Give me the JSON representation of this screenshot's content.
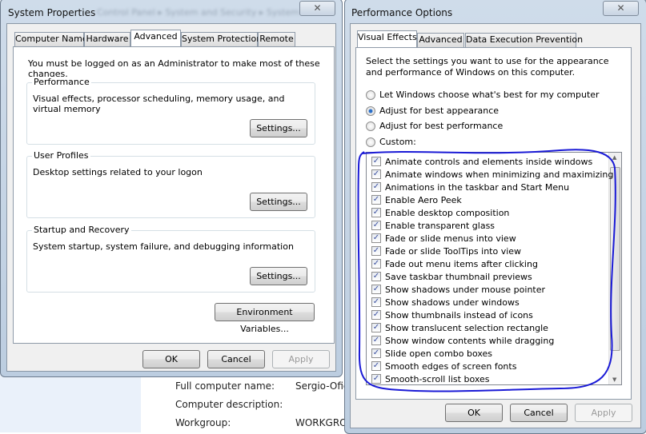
{
  "background": {
    "breadcrumb": "Control Panel ▸ System and Security ▸ System",
    "rows": [
      {
        "label": "Full computer name:",
        "value": "Sergio-Ofic"
      },
      {
        "label": "Computer description:",
        "value": ""
      },
      {
        "label": "Workgroup:",
        "value": "WORKGROU"
      }
    ]
  },
  "system_properties": {
    "title": "System Properties",
    "close_icon": "close-icon",
    "tabs": [
      {
        "label": "Computer Name"
      },
      {
        "label": "Hardware"
      },
      {
        "label": "Advanced",
        "selected": true
      },
      {
        "label": "System Protection"
      },
      {
        "label": "Remote"
      }
    ],
    "admin_note": "You must be logged on as an Administrator to make most of these changes.",
    "groups": [
      {
        "title": "Performance",
        "description": "Visual effects, processor scheduling, memory usage, and virtual memory",
        "button": "Settings..."
      },
      {
        "title": "User Profiles",
        "description": "Desktop settings related to your logon",
        "button": "Settings..."
      },
      {
        "title": "Startup and Recovery",
        "description": "System startup, system failure, and debugging information",
        "button": "Settings..."
      }
    ],
    "env_button": "Environment Variables...",
    "ok": "OK",
    "cancel": "Cancel",
    "apply": "Apply"
  },
  "performance_options": {
    "title": "Performance Options",
    "tabs": [
      {
        "label": "Visual Effects",
        "selected": true
      },
      {
        "label": "Advanced"
      },
      {
        "label": "Data Execution Prevention"
      }
    ],
    "description": "Select the settings you want to use for the appearance and performance of Windows on this computer.",
    "radios": [
      {
        "label": "Let Windows choose what's best for my computer",
        "selected": false
      },
      {
        "label": "Adjust for best appearance",
        "selected": true
      },
      {
        "label": "Adjust for best performance",
        "selected": false
      },
      {
        "label": "Custom:",
        "selected": false
      }
    ],
    "effects": [
      {
        "label": "Animate controls and elements inside windows",
        "checked": true
      },
      {
        "label": "Animate windows when minimizing and maximizing",
        "checked": true
      },
      {
        "label": "Animations in the taskbar and Start Menu",
        "checked": true
      },
      {
        "label": "Enable Aero Peek",
        "checked": true
      },
      {
        "label": "Enable desktop composition",
        "checked": true
      },
      {
        "label": "Enable transparent glass",
        "checked": true
      },
      {
        "label": "Fade or slide menus into view",
        "checked": true
      },
      {
        "label": "Fade or slide ToolTips into view",
        "checked": true
      },
      {
        "label": "Fade out menu items after clicking",
        "checked": true
      },
      {
        "label": "Save taskbar thumbnail previews",
        "checked": true
      },
      {
        "label": "Show shadows under mouse pointer",
        "checked": true
      },
      {
        "label": "Show shadows under windows",
        "checked": true
      },
      {
        "label": "Show thumbnails instead of icons",
        "checked": true
      },
      {
        "label": "Show translucent selection rectangle",
        "checked": true
      },
      {
        "label": "Show window contents while dragging",
        "checked": true
      },
      {
        "label": "Slide open combo boxes",
        "checked": true
      },
      {
        "label": "Smooth edges of screen fonts",
        "checked": true
      },
      {
        "label": "Smooth-scroll list boxes",
        "checked": true
      }
    ],
    "ok": "OK",
    "cancel": "Cancel",
    "apply": "Apply",
    "annotation_color": "#1a1ad6"
  }
}
